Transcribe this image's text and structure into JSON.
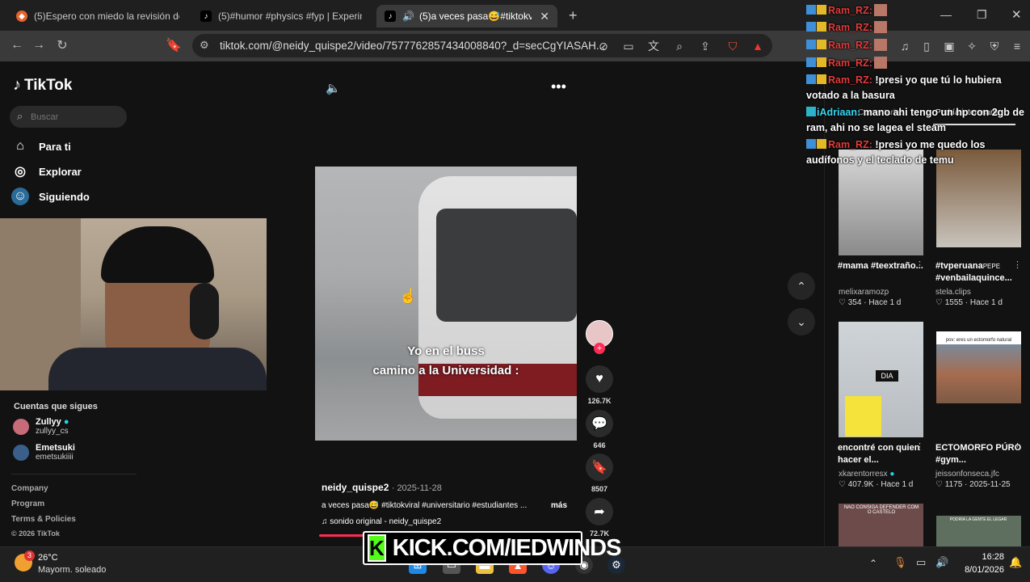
{
  "browser": {
    "tabs": [
      {
        "label": "(5)Espero con miedo la revisión de n",
        "active": false
      },
      {
        "label": "(5)#humor #physics #fyp | Experimen",
        "active": false
      },
      {
        "label": "(5)a veces pasa😅#tiktokviral",
        "active": true
      }
    ],
    "new_tab_label": "+",
    "url": "tiktok.com/@neidy_quispe2/video/7577762857434008840?_d=secCgYIASAH..."
  },
  "tiktok": {
    "logo_text": "TikTok",
    "search_placeholder": "Buscar",
    "nav": [
      {
        "label": "Para ti",
        "icon": "home-icon"
      },
      {
        "label": "Explorar",
        "icon": "compass-icon"
      },
      {
        "label": "Siguiendo",
        "icon": "following-icon"
      }
    ],
    "following_title": "Cuentas que sigues",
    "accounts": [
      {
        "name": "Zullyy",
        "handle": "zullyy_cs",
        "verified": true
      },
      {
        "name": "Emetsuki",
        "handle": "emetsukiiii",
        "verified": false
      }
    ],
    "footer": [
      "Company",
      "Program",
      "Terms & Policies",
      "© 2026 TikTok"
    ],
    "video": {
      "caption_line1": "Yo en el buss",
      "caption_line2": "camino a la Universidad :",
      "author": "neidy_quispe2",
      "date": "· 2025-11-28",
      "description": "a veces pasa😅 #tiktokviral #universitario #estudiantes ...",
      "more_label": "más",
      "sound": "sonido original - neidy_quispe2",
      "likes": "126.7K",
      "comments": "646",
      "saves": "8507",
      "shares": "72.7K",
      "progress": 0.12
    },
    "related_tabs": [
      "Comentarios",
      "Podría interesarte"
    ],
    "related": [
      {
        "title": "#mama #teextraño...",
        "user": "melixaramozp",
        "likes": "354",
        "time": "Hace 1 d"
      },
      {
        "title": "#tvperuana",
        "title2": "#venbailaquince...",
        "user": "stela.clips",
        "likes": "1555",
        "time": "Hace 1 d"
      },
      {
        "title": "encontré con quien hacer el...",
        "user": "xkarentorresx",
        "likes": "407.9K",
        "time": "Hace 1 d"
      },
      {
        "title": "ECTOMORFO PÚRO #gym...",
        "user": "jeissonfonseca.jfc",
        "likes": "1175",
        "time": "2025-11-25"
      }
    ],
    "thumb_texts": {
      "dia": "DIA",
      "ecto": "pov: eres un ectomorfo natural",
      "game": "NAO CONSIGA DEFENDER COM O CASTELO",
      "game2": "PODRIA LA GENTE EL LEGAR"
    }
  },
  "chat": [
    {
      "user": "Ram_RZ:",
      "color": "red",
      "text": ""
    },
    {
      "user": "Ram_RZ:",
      "color": "red",
      "text": ""
    },
    {
      "user": "Ram_RZ:",
      "color": "red",
      "text": ""
    },
    {
      "user": "Ram_RZ:",
      "color": "red",
      "text": ""
    },
    {
      "user": "Ram_RZ:",
      "color": "red",
      "text": "!presi yo que tú lo hubiera votado a la basura"
    },
    {
      "user": "iAdriaan:",
      "color": "cyan",
      "text": "mano ahi tengo un hp con 2gb de ram, ahi no se lagea el steam"
    },
    {
      "user": "Ram_RZ:",
      "color": "red",
      "text": "!presi yo me quedo los audífonos y el teclado de temu"
    }
  ],
  "kick": {
    "k": "K",
    "text": "KICK.COM/IEDWINDS"
  },
  "taskbar": {
    "weather_temp": "26°C",
    "weather_desc": "Mayorm. soleado",
    "weather_badge": "3",
    "time": "16:28",
    "date": "8/01/2026"
  },
  "colors": {
    "accent": "#fe2c55",
    "kick_green": "#53fc18",
    "chat_red": "#e23b3b",
    "chat_cyan": "#38d6f2"
  }
}
